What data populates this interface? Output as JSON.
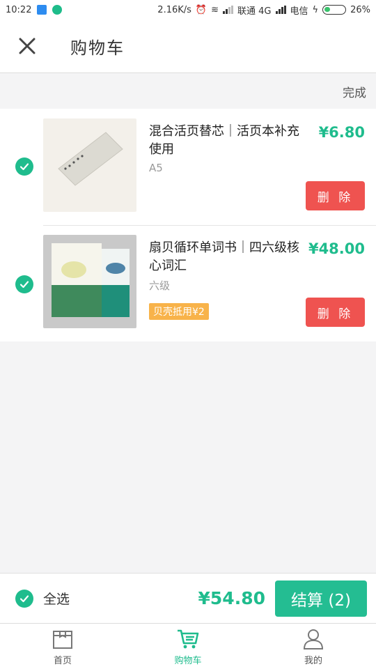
{
  "status_bar": {
    "time": "10:22",
    "speed": "2.16K/s",
    "carrier1": "联通 4G",
    "carrier2": "电信",
    "battery": "26%"
  },
  "app_bar": {
    "close_icon": "close-icon",
    "title": "购物车"
  },
  "edit": {
    "done_label": "完成"
  },
  "cart": {
    "items": [
      {
        "name": "混合活页替芯｜活页本补充使用",
        "spec": "A5",
        "price": "¥6.80",
        "delete_label": "删 除",
        "checked": true
      },
      {
        "name": "扇贝循环单词书｜四六级核心词汇",
        "spec": "六级",
        "price": "¥48.00",
        "coupon": "贝壳抵用¥2",
        "delete_label": "删 除",
        "checked": true
      }
    ]
  },
  "bottom": {
    "select_all_label": "全选",
    "total": "¥54.80",
    "checkout_label": "结算 (2)"
  },
  "tabs": [
    {
      "label": "首页",
      "icon": "home-box-icon",
      "active": false
    },
    {
      "label": "购物车",
      "icon": "cart-icon",
      "active": true
    },
    {
      "label": "我的",
      "icon": "user-icon",
      "active": false
    }
  ],
  "colors": {
    "accent": "#1fbc8d",
    "delete": "#ef5350",
    "coupon": "#f8b34a"
  }
}
